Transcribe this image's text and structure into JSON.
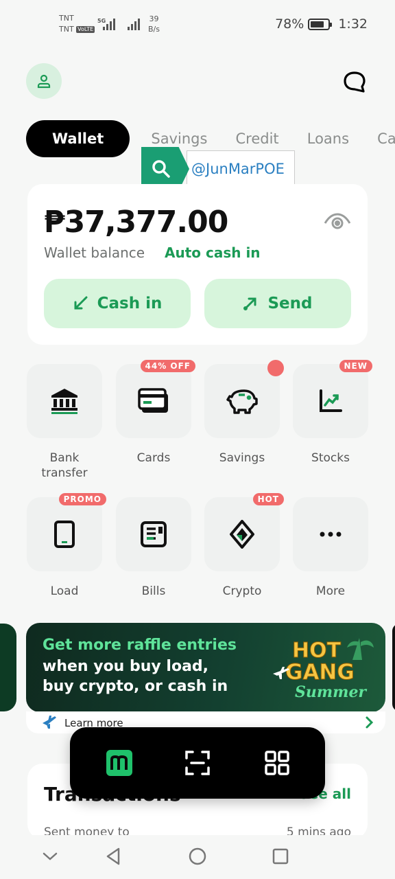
{
  "status_bar": {
    "carrier1": "TNT",
    "carrier2": "TNT",
    "volte": "VoLTE",
    "network": "5G",
    "speed_value": "39",
    "speed_unit": "B/s",
    "battery": "78%",
    "time": "1:32"
  },
  "header": {
    "avatar_icon": "user-icon",
    "chat_icon": "chat-bubble-icon"
  },
  "tabs": [
    {
      "label": "Wallet",
      "active": true
    },
    {
      "label": "Savings",
      "active": false
    },
    {
      "label": "Credit",
      "active": false
    },
    {
      "label": "Loans",
      "active": false
    },
    {
      "label": "Ca",
      "active": false
    }
  ],
  "watermark": {
    "handle": "@JunMarPOE"
  },
  "balance": {
    "amount": "₱37,377.00",
    "label": "Wallet balance",
    "auto_cash_in": "Auto cash in",
    "cash_in": "Cash in",
    "send": "Send"
  },
  "services": [
    {
      "label": "Bank transfer",
      "icon": "bank-icon",
      "badge": ""
    },
    {
      "label": "Cards",
      "icon": "cards-icon",
      "badge": "44% OFF"
    },
    {
      "label": "Savings",
      "icon": "piggy-bank-icon",
      "badge": "dot"
    },
    {
      "label": "Stocks",
      "icon": "stocks-chart-icon",
      "badge": "NEW"
    },
    {
      "label": "Load",
      "icon": "phone-icon",
      "badge": "PROMO"
    },
    {
      "label": "Bills",
      "icon": "bills-icon",
      "badge": ""
    },
    {
      "label": "Crypto",
      "icon": "crypto-icon",
      "badge": "HOT"
    },
    {
      "label": "More",
      "icon": "more-dots-icon",
      "badge": ""
    }
  ],
  "promo": {
    "line1": "Get more raffle entries",
    "line2": "when you buy load,",
    "line3": "buy crypto, or cash in",
    "art_title1": "HOT",
    "art_title2": "GANG",
    "art_title3": "Summer",
    "learn_more": "Learn more"
  },
  "transactions": {
    "title": "Transactions",
    "see_all": "See all",
    "row_left": "Sent money to",
    "row_right": "5 mins ago"
  },
  "colors": {
    "accent_green": "#1b9a55",
    "light_green": "#d7f5dc",
    "badge_red": "#f16b6b",
    "dark": "#000000"
  }
}
